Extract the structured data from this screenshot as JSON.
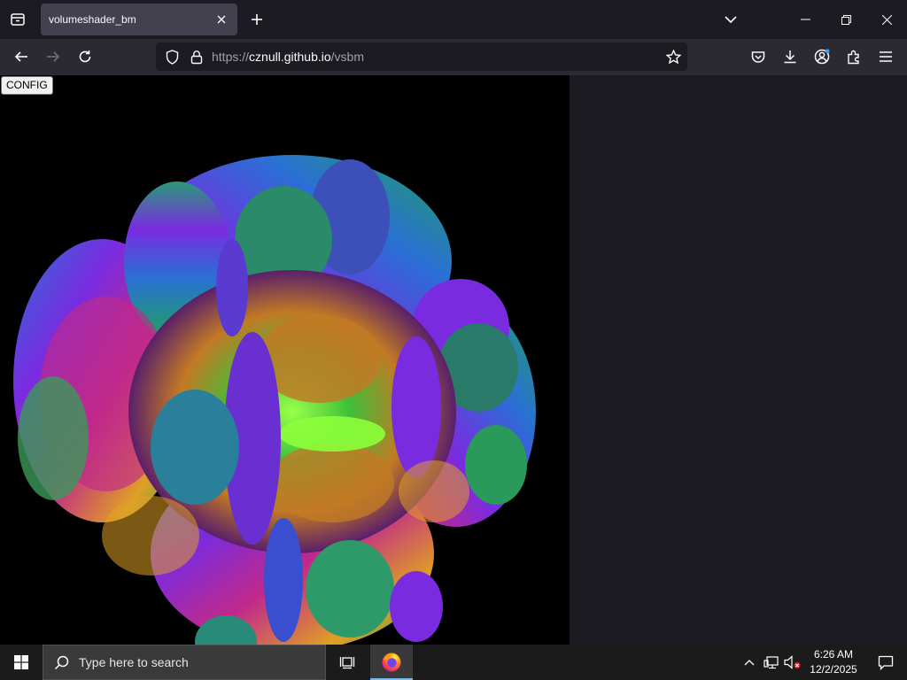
{
  "browser": {
    "tab": {
      "title": "volumeshader_bm"
    },
    "url": {
      "scheme": "https://",
      "host": "cznull.github.io",
      "path": "/vsbm"
    }
  },
  "page": {
    "config_button": "CONFIG",
    "canvas_background": "#000000",
    "render_palette": [
      "#7a2be0",
      "#2a6fd6",
      "#1fa35a",
      "#7ed321",
      "#e0a024",
      "#c0298a"
    ]
  },
  "taskbar": {
    "search_placeholder": "Type here to search",
    "clock": {
      "time": "6:26 AM",
      "date": "12/2/2025"
    }
  },
  "icons": {
    "tab_strip": [
      "tab-list-icon",
      "close-icon",
      "plus-icon",
      "chevron-down-icon",
      "minimize-icon",
      "maximize-icon",
      "close-icon"
    ],
    "nav": [
      "back-arrow-icon",
      "forward-arrow-icon",
      "reload-icon",
      "shield-icon",
      "lock-icon",
      "star-icon",
      "pocket-icon",
      "download-icon",
      "account-icon",
      "extensions-icon",
      "menu-icon"
    ],
    "taskbar": [
      "windows-start-icon",
      "search-icon",
      "task-view-icon",
      "firefox-icon",
      "chevron-up-icon",
      "network-icon",
      "volume-muted-icon",
      "notification-icon"
    ]
  },
  "colors": {
    "chrome_dark": "#1c1b22",
    "toolbar": "#2b2a33",
    "tab_active": "#42414d",
    "taskbar": "#1b1b1b"
  }
}
